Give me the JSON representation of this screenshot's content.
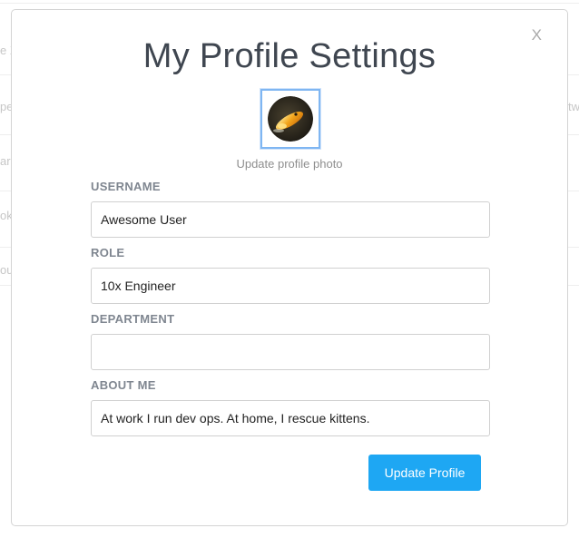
{
  "modal": {
    "title": "My Profile Settings",
    "close_label": "X",
    "photo_caption": "Update profile photo",
    "submit_label": "Update Profile"
  },
  "fields": {
    "username": {
      "label": "USERNAME",
      "value": "Awesome User"
    },
    "role": {
      "label": "ROLE",
      "value": "10x Engineer"
    },
    "department": {
      "label": "DEPARTMENT",
      "value": ""
    },
    "about": {
      "label": "ABOUT ME",
      "value": "At work I run dev ops. At home, I rescue kittens."
    }
  },
  "background": {
    "fragments": [
      "e X",
      "pe",
      "ar",
      "ok",
      "ou",
      "tw"
    ]
  },
  "colors": {
    "title": "#3f4650",
    "label": "#7f8690",
    "button": "#1ea7f3",
    "photo_border": "#7fb6f2"
  }
}
